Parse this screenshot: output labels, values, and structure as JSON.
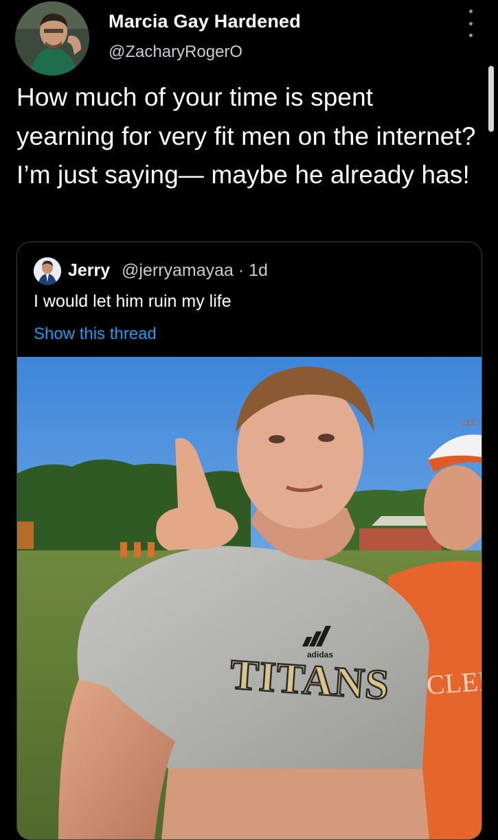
{
  "tweet": {
    "author": {
      "display_name": "Marcia Gay Hardened",
      "handle": "@ZacharyRogerO",
      "avatar_icon": "user-avatar"
    },
    "more_icon": "more-options-icon",
    "text": "How much of your time is spent yearning for very fit men on the internet? I’m just saying— maybe he already has!"
  },
  "quoted_tweet": {
    "author": {
      "display_name": "Jerry",
      "handle_meta": "@jerryamayaa · 1d",
      "avatar_icon": "user-avatar"
    },
    "text": "I would let him ruin my life",
    "show_thread_label": "Show this thread",
    "media": {
      "description_icon": "photo-icon",
      "shirt_text": "TITANS",
      "shirt_brand": "adidas",
      "cap_text": "CLE",
      "right_shirt_text": "CLEM"
    }
  },
  "colors": {
    "background": "#000000",
    "link": "#1d9bf0",
    "secondary_text": "#c9cdd1",
    "border": "#3a3d41"
  }
}
